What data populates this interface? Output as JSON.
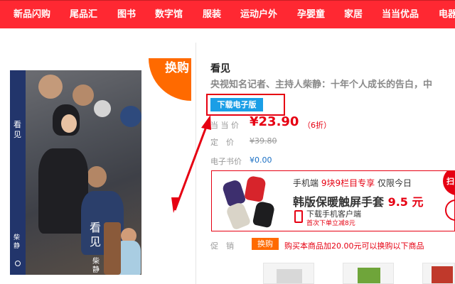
{
  "nav": {
    "items": [
      "新品闪购",
      "尾品汇",
      "图书",
      "数字馆",
      "服装",
      "运动户外",
      "孕婴童",
      "家居",
      "当当优品",
      "电器"
    ]
  },
  "book": {
    "cover_title": "看见",
    "cover_author": "柴静",
    "spine_title": "看见",
    "spine_author": "柴静",
    "badge": "换购",
    "title": "看见",
    "subtitle": "央视知名记者、主持人柴静：十年个人成长的告白，中"
  },
  "ebook_button": "下载电子版",
  "price": {
    "dangdang_label": "当 当 价",
    "dangdang_value": "¥23.90",
    "discount": "（6折）",
    "list_label": "定　价",
    "list_value": "¥39.80",
    "ebook_label": "电子书价",
    "ebook_value": "¥0.00"
  },
  "ad": {
    "line1_prefix": "手机端",
    "line1_highlight": "9块9栏目专享",
    "line1_suffix": "仅限今日",
    "line2_text": "韩版保暖触屏手套",
    "line2_price": "9.5 元",
    "line3": "下载手机客户端",
    "line4": "首次下单立减8元",
    "corner": "扫"
  },
  "promo": {
    "label": "促　销",
    "tag": "换购",
    "text": "购买本商品加20.00元可以换购以下商品"
  },
  "colors": {
    "nav_red": "#ff2832",
    "price_red": "#e60012",
    "ebook_blue": "#1a9ee6",
    "badge_orange": "#ff6a00"
  }
}
